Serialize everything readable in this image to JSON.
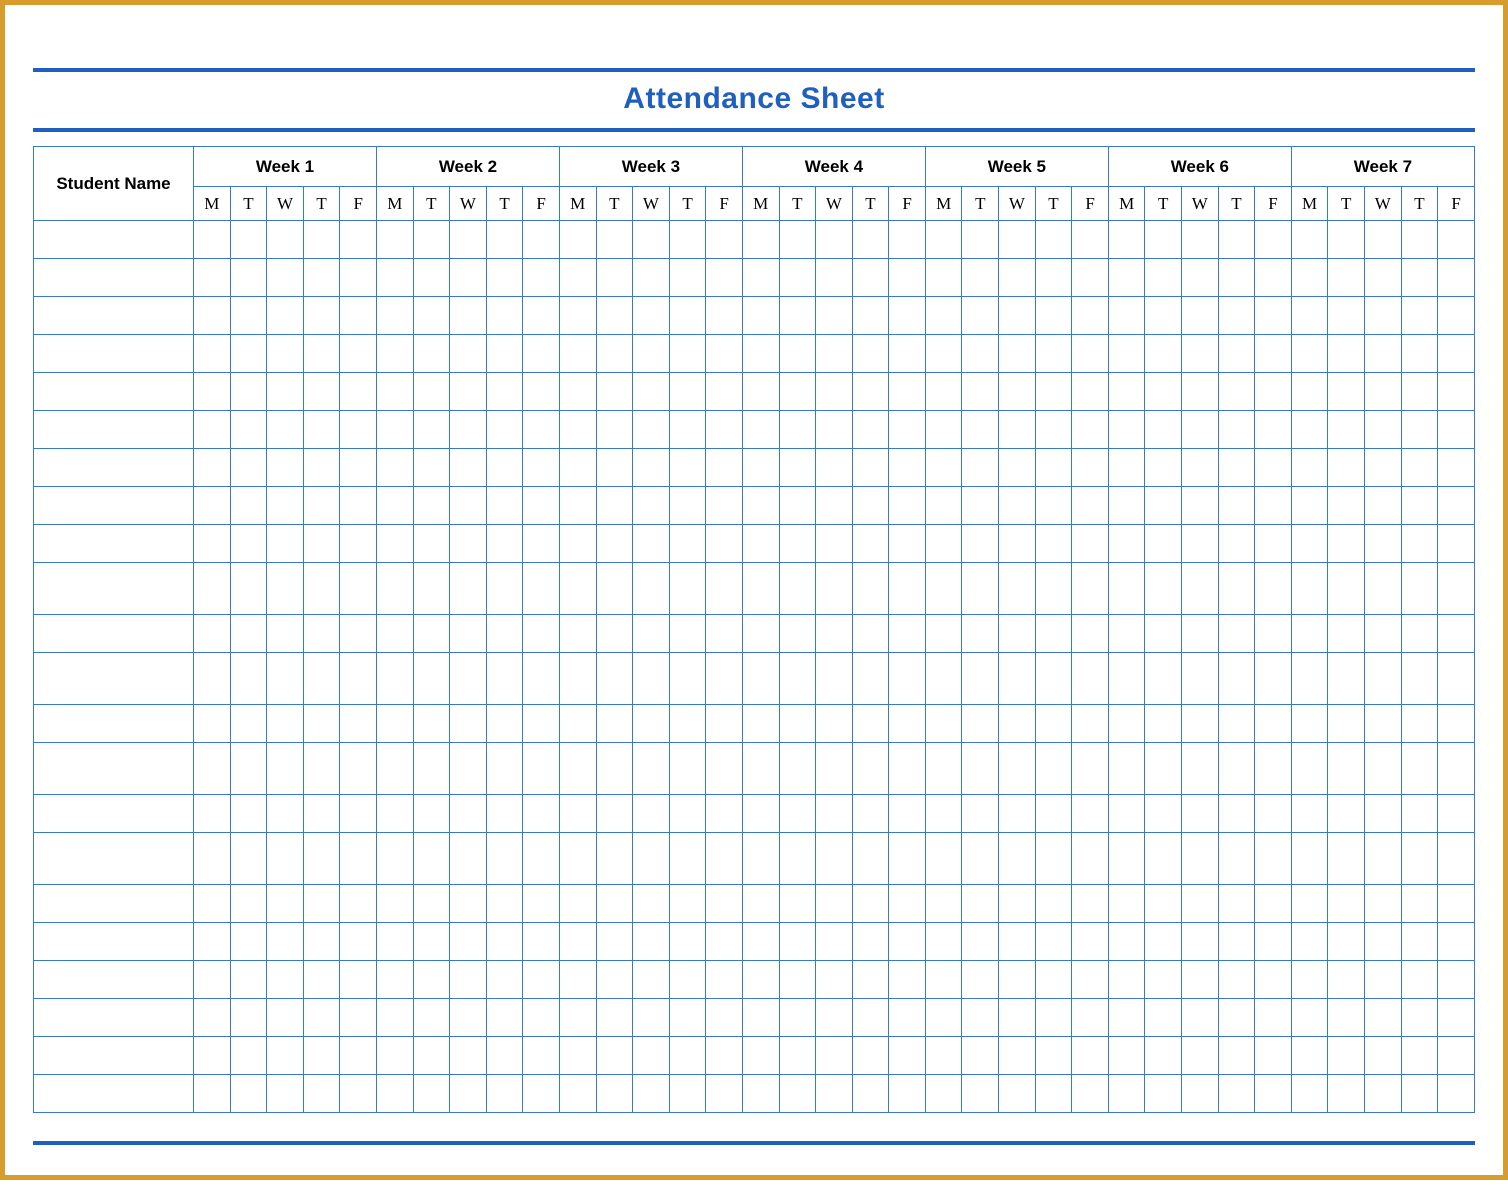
{
  "title": "Attendance Sheet",
  "headers": {
    "name": "Student Name",
    "weeks": [
      "Week 1",
      "Week 2",
      "Week 3",
      "Week 4",
      "Week 5",
      "Week 6",
      "Week 7"
    ],
    "days": [
      "M",
      "T",
      "W",
      "T",
      "F"
    ]
  },
  "row_count": 22,
  "tall_rows": [
    9,
    11,
    13,
    15
  ],
  "colors": {
    "border_frame": "#d89c2d",
    "accent": "#1f5fbf",
    "grid": "#3a7bbf"
  }
}
